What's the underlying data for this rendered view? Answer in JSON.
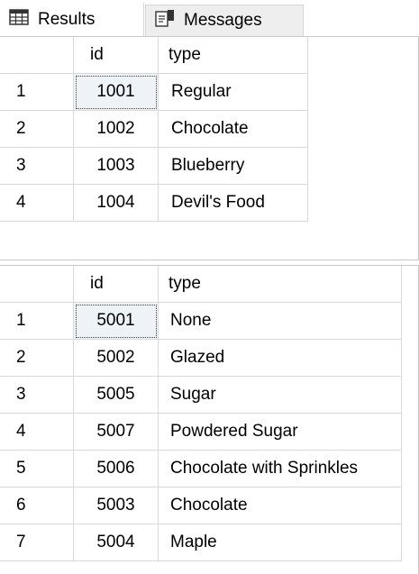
{
  "tabs": {
    "results_label": "Results",
    "messages_label": "Messages"
  },
  "grid1": {
    "columns": [
      "",
      "id",
      "type"
    ],
    "rows": [
      {
        "num": "1",
        "id": "1001",
        "type": "Regular"
      },
      {
        "num": "2",
        "id": "1002",
        "type": "Chocolate"
      },
      {
        "num": "3",
        "id": "1003",
        "type": "Blueberry"
      },
      {
        "num": "4",
        "id": "1004",
        "type": "Devil's Food"
      }
    ]
  },
  "grid2": {
    "columns": [
      "",
      "id",
      "type"
    ],
    "rows": [
      {
        "num": "1",
        "id": "5001",
        "type": "None"
      },
      {
        "num": "2",
        "id": "5002",
        "type": "Glazed"
      },
      {
        "num": "3",
        "id": "5005",
        "type": "Sugar"
      },
      {
        "num": "4",
        "id": "5007",
        "type": "Powdered Sugar"
      },
      {
        "num": "5",
        "id": "5006",
        "type": "Chocolate with Sprinkles"
      },
      {
        "num": "6",
        "id": "5003",
        "type": "Chocolate"
      },
      {
        "num": "7",
        "id": "5004",
        "type": "Maple"
      }
    ]
  },
  "icons": {
    "results": "grid-icon",
    "messages": "messages-icon"
  }
}
